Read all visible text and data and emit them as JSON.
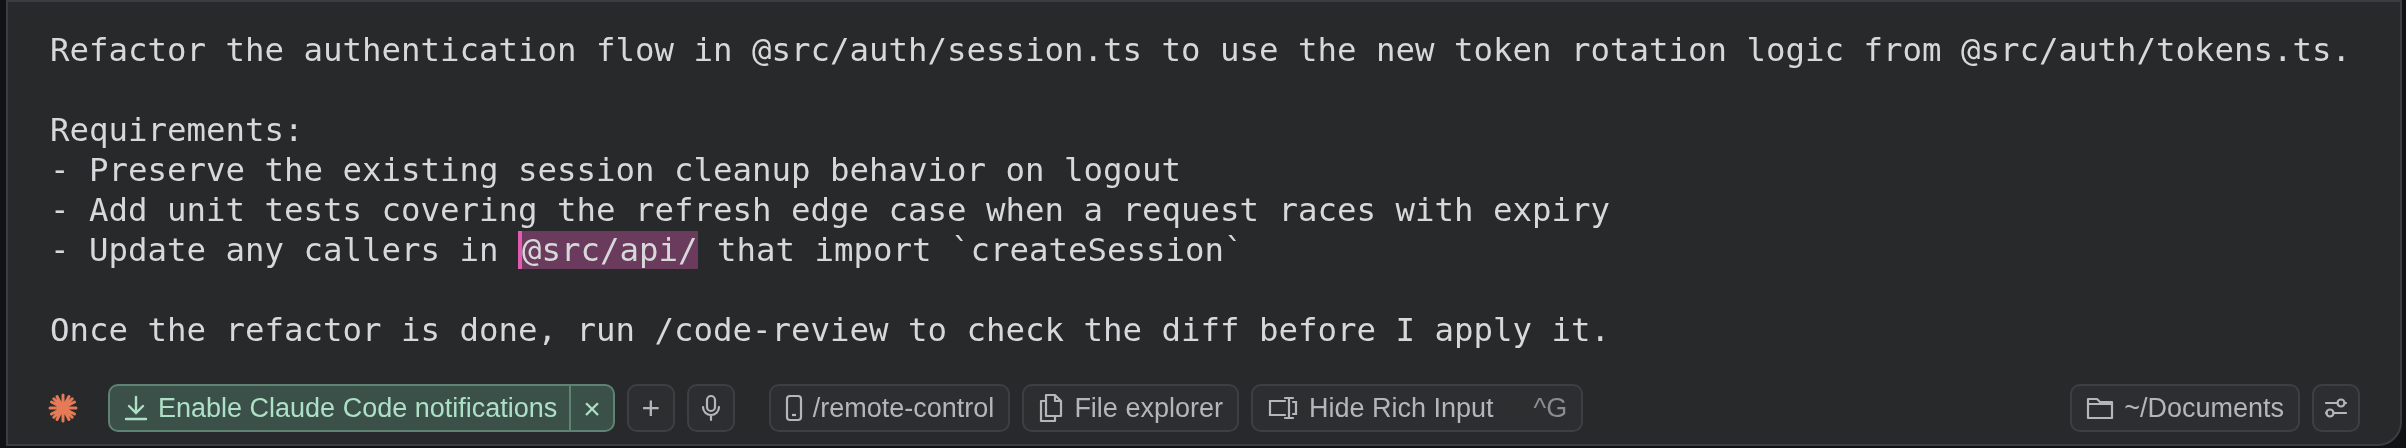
{
  "editor": {
    "lines": [
      {
        "kind": "text",
        "text": "Refactor the authentication flow in @src/auth/session.ts to use the new token rotation logic from @src/auth/tokens.ts."
      },
      {
        "kind": "blank"
      },
      {
        "kind": "text",
        "text": "Requirements:"
      },
      {
        "kind": "text",
        "text": "- Preserve the existing session cleanup behavior on logout"
      },
      {
        "kind": "text",
        "text": "- Add unit tests covering the refresh edge case when a request races with expiry"
      },
      {
        "kind": "mention",
        "before": "- Update any callers in ",
        "mention": "@src/api/",
        "after": " that import `createSession`"
      },
      {
        "kind": "blank"
      },
      {
        "kind": "text",
        "text": "Once the refactor is done, run /code-review to check the diff before I apply it."
      }
    ]
  },
  "toolbar": {
    "notification": {
      "label": "Enable Claude Code notifications",
      "close": "×"
    },
    "buttons": [
      {
        "kind": "plus",
        "label": "+"
      },
      {
        "kind": "mic"
      },
      {
        "kind": "phone",
        "label": "/remote-control"
      },
      {
        "kind": "files",
        "label": "File explorer"
      },
      {
        "kind": "rich",
        "label": "Hide Rich Input",
        "shortcut": "^G"
      }
    ],
    "right": [
      {
        "kind": "folder",
        "label": "~/Documents"
      },
      {
        "kind": "settings"
      }
    ]
  }
}
